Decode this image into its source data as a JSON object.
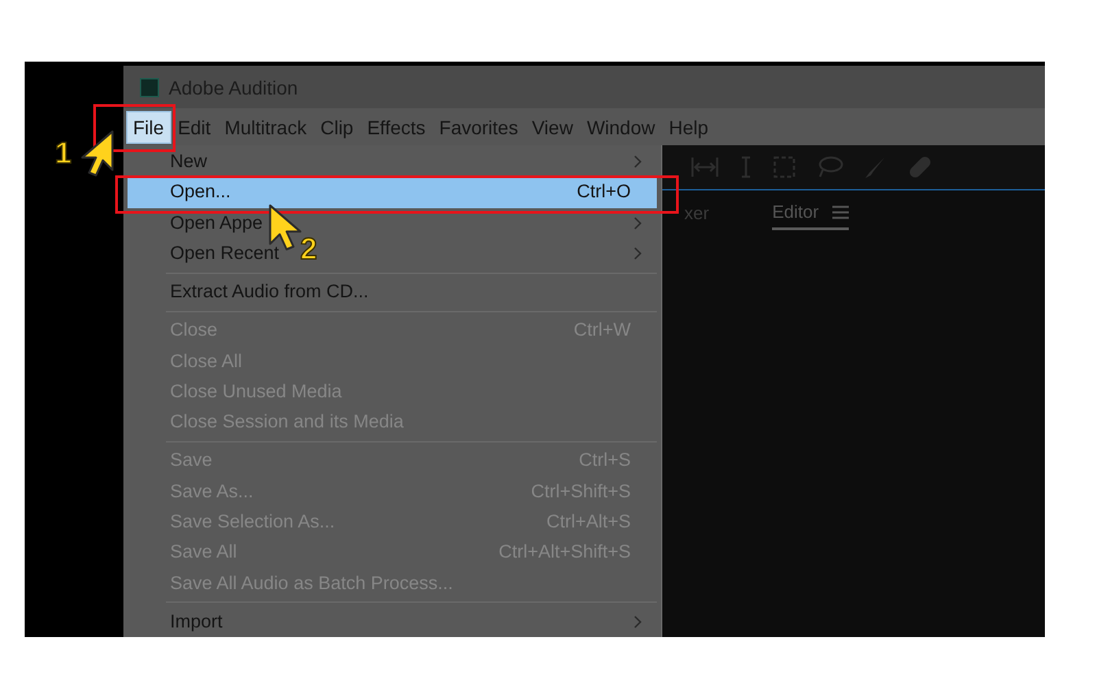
{
  "window": {
    "title": "Adobe Audition"
  },
  "menu_bar": [
    {
      "label": "File",
      "selected": true
    },
    {
      "label": "Edit",
      "selected": false
    },
    {
      "label": "Multitrack",
      "selected": false
    },
    {
      "label": "Clip",
      "selected": false
    },
    {
      "label": "Effects",
      "selected": false
    },
    {
      "label": "Favorites",
      "selected": false
    },
    {
      "label": "View",
      "selected": false
    },
    {
      "label": "Window",
      "selected": false
    },
    {
      "label": "Help",
      "selected": false
    }
  ],
  "file_menu": [
    {
      "kind": "item",
      "label": "New",
      "submenu": true,
      "disabled": false,
      "selected": false
    },
    {
      "kind": "item",
      "label": "Open...",
      "shortcut": "Ctrl+O",
      "disabled": false,
      "selected": true
    },
    {
      "kind": "item",
      "label": "Open Appe",
      "submenu": true,
      "disabled": false,
      "selected": false
    },
    {
      "kind": "item",
      "label": "Open Recent",
      "submenu": true,
      "disabled": false,
      "selected": false
    },
    {
      "kind": "separator"
    },
    {
      "kind": "item",
      "label": "Extract Audio from CD...",
      "disabled": false,
      "selected": false
    },
    {
      "kind": "separator"
    },
    {
      "kind": "item",
      "label": "Close",
      "shortcut": "Ctrl+W",
      "disabled": true,
      "selected": false
    },
    {
      "kind": "item",
      "label": "Close All",
      "disabled": true,
      "selected": false
    },
    {
      "kind": "item",
      "label": "Close Unused Media",
      "disabled": true,
      "selected": false
    },
    {
      "kind": "item",
      "label": "Close Session and its Media",
      "disabled": true,
      "selected": false
    },
    {
      "kind": "separator"
    },
    {
      "kind": "item",
      "label": "Save",
      "shortcut": "Ctrl+S",
      "disabled": true,
      "selected": false
    },
    {
      "kind": "item",
      "label": "Save As...",
      "shortcut": "Ctrl+Shift+S",
      "disabled": true,
      "selected": false
    },
    {
      "kind": "item",
      "label": "Save Selection As...",
      "shortcut": "Ctrl+Alt+S",
      "disabled": true,
      "selected": false
    },
    {
      "kind": "item",
      "label": "Save All",
      "shortcut": "Ctrl+Alt+Shift+S",
      "disabled": true,
      "selected": false
    },
    {
      "kind": "item",
      "label": "Save All Audio as Batch Process...",
      "disabled": true,
      "selected": false
    },
    {
      "kind": "separator"
    },
    {
      "kind": "item",
      "label": "Import",
      "submenu": true,
      "disabled": false,
      "selected": false
    }
  ],
  "panel_tabs": [
    {
      "label": "xer",
      "selected": false
    },
    {
      "label": "Editor",
      "selected": true
    }
  ],
  "callouts": [
    {
      "number": "1"
    },
    {
      "number": "2"
    }
  ]
}
